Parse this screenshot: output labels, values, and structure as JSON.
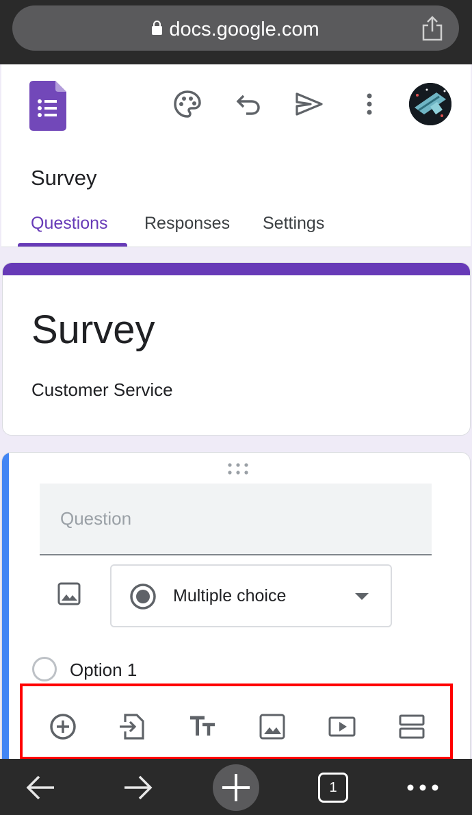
{
  "browser": {
    "url": "docs.google.com",
    "tab_count": "1"
  },
  "form": {
    "header_title": "Survey",
    "tabs": [
      {
        "label": "Questions"
      },
      {
        "label": "Responses"
      },
      {
        "label": "Settings"
      }
    ],
    "title": "Survey",
    "description": "Customer Service",
    "question_placeholder": "Question",
    "question_type": "Multiple choice",
    "option_1": "Option 1"
  },
  "icons": {
    "header": [
      "palette-icon",
      "undo-icon",
      "send-icon",
      "more-vert-icon"
    ],
    "toolbar": [
      "add-question-icon",
      "import-questions-icon",
      "add-title-icon",
      "add-image-icon",
      "add-video-icon",
      "add-section-icon"
    ]
  },
  "colors": {
    "accent": "#673ab7",
    "question_accent": "#4285f4",
    "highlight": "#ff0000"
  }
}
